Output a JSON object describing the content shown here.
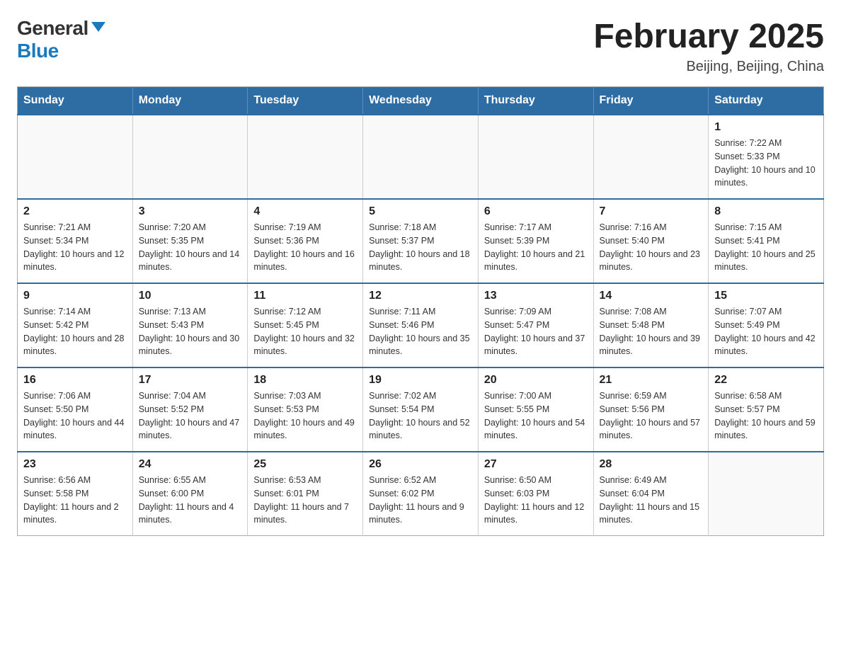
{
  "logo": {
    "general": "General",
    "blue": "Blue"
  },
  "header": {
    "title": "February 2025",
    "location": "Beijing, Beijing, China"
  },
  "days_of_week": [
    "Sunday",
    "Monday",
    "Tuesday",
    "Wednesday",
    "Thursday",
    "Friday",
    "Saturday"
  ],
  "weeks": [
    [
      {
        "day": "",
        "info": ""
      },
      {
        "day": "",
        "info": ""
      },
      {
        "day": "",
        "info": ""
      },
      {
        "day": "",
        "info": ""
      },
      {
        "day": "",
        "info": ""
      },
      {
        "day": "",
        "info": ""
      },
      {
        "day": "1",
        "info": "Sunrise: 7:22 AM\nSunset: 5:33 PM\nDaylight: 10 hours and 10 minutes."
      }
    ],
    [
      {
        "day": "2",
        "info": "Sunrise: 7:21 AM\nSunset: 5:34 PM\nDaylight: 10 hours and 12 minutes."
      },
      {
        "day": "3",
        "info": "Sunrise: 7:20 AM\nSunset: 5:35 PM\nDaylight: 10 hours and 14 minutes."
      },
      {
        "day": "4",
        "info": "Sunrise: 7:19 AM\nSunset: 5:36 PM\nDaylight: 10 hours and 16 minutes."
      },
      {
        "day": "5",
        "info": "Sunrise: 7:18 AM\nSunset: 5:37 PM\nDaylight: 10 hours and 18 minutes."
      },
      {
        "day": "6",
        "info": "Sunrise: 7:17 AM\nSunset: 5:39 PM\nDaylight: 10 hours and 21 minutes."
      },
      {
        "day": "7",
        "info": "Sunrise: 7:16 AM\nSunset: 5:40 PM\nDaylight: 10 hours and 23 minutes."
      },
      {
        "day": "8",
        "info": "Sunrise: 7:15 AM\nSunset: 5:41 PM\nDaylight: 10 hours and 25 minutes."
      }
    ],
    [
      {
        "day": "9",
        "info": "Sunrise: 7:14 AM\nSunset: 5:42 PM\nDaylight: 10 hours and 28 minutes."
      },
      {
        "day": "10",
        "info": "Sunrise: 7:13 AM\nSunset: 5:43 PM\nDaylight: 10 hours and 30 minutes."
      },
      {
        "day": "11",
        "info": "Sunrise: 7:12 AM\nSunset: 5:45 PM\nDaylight: 10 hours and 32 minutes."
      },
      {
        "day": "12",
        "info": "Sunrise: 7:11 AM\nSunset: 5:46 PM\nDaylight: 10 hours and 35 minutes."
      },
      {
        "day": "13",
        "info": "Sunrise: 7:09 AM\nSunset: 5:47 PM\nDaylight: 10 hours and 37 minutes."
      },
      {
        "day": "14",
        "info": "Sunrise: 7:08 AM\nSunset: 5:48 PM\nDaylight: 10 hours and 39 minutes."
      },
      {
        "day": "15",
        "info": "Sunrise: 7:07 AM\nSunset: 5:49 PM\nDaylight: 10 hours and 42 minutes."
      }
    ],
    [
      {
        "day": "16",
        "info": "Sunrise: 7:06 AM\nSunset: 5:50 PM\nDaylight: 10 hours and 44 minutes."
      },
      {
        "day": "17",
        "info": "Sunrise: 7:04 AM\nSunset: 5:52 PM\nDaylight: 10 hours and 47 minutes."
      },
      {
        "day": "18",
        "info": "Sunrise: 7:03 AM\nSunset: 5:53 PM\nDaylight: 10 hours and 49 minutes."
      },
      {
        "day": "19",
        "info": "Sunrise: 7:02 AM\nSunset: 5:54 PM\nDaylight: 10 hours and 52 minutes."
      },
      {
        "day": "20",
        "info": "Sunrise: 7:00 AM\nSunset: 5:55 PM\nDaylight: 10 hours and 54 minutes."
      },
      {
        "day": "21",
        "info": "Sunrise: 6:59 AM\nSunset: 5:56 PM\nDaylight: 10 hours and 57 minutes."
      },
      {
        "day": "22",
        "info": "Sunrise: 6:58 AM\nSunset: 5:57 PM\nDaylight: 10 hours and 59 minutes."
      }
    ],
    [
      {
        "day": "23",
        "info": "Sunrise: 6:56 AM\nSunset: 5:58 PM\nDaylight: 11 hours and 2 minutes."
      },
      {
        "day": "24",
        "info": "Sunrise: 6:55 AM\nSunset: 6:00 PM\nDaylight: 11 hours and 4 minutes."
      },
      {
        "day": "25",
        "info": "Sunrise: 6:53 AM\nSunset: 6:01 PM\nDaylight: 11 hours and 7 minutes."
      },
      {
        "day": "26",
        "info": "Sunrise: 6:52 AM\nSunset: 6:02 PM\nDaylight: 11 hours and 9 minutes."
      },
      {
        "day": "27",
        "info": "Sunrise: 6:50 AM\nSunset: 6:03 PM\nDaylight: 11 hours and 12 minutes."
      },
      {
        "day": "28",
        "info": "Sunrise: 6:49 AM\nSunset: 6:04 PM\nDaylight: 11 hours and 15 minutes."
      },
      {
        "day": "",
        "info": ""
      }
    ]
  ]
}
